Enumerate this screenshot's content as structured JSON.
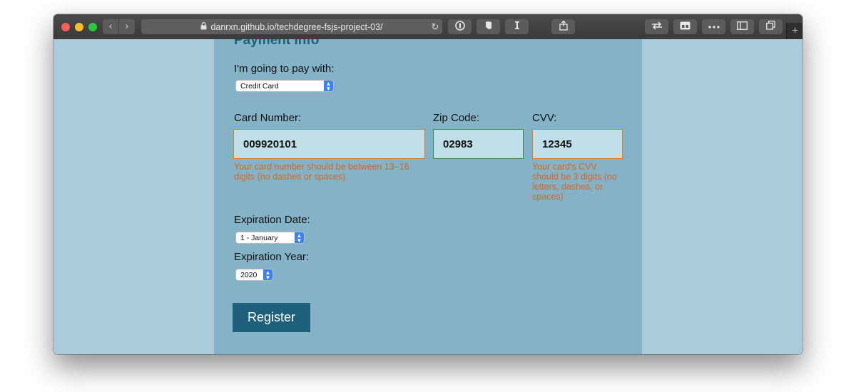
{
  "browser": {
    "url": "danrxn.github.io/techdegree-fsjs-project-03/",
    "nav_back_icon": "‹",
    "nav_forward_icon": "›",
    "lock_icon": "🔒",
    "reload_icon": "↻",
    "new_tab_icon": "+"
  },
  "payment": {
    "title": "Payment Info",
    "pay_with_label": "I'm going to pay with:",
    "pay_with_selected": "Credit Card",
    "card_number_label": "Card Number:",
    "card_number_value": "009920101",
    "card_number_error": "Your card number should be between 13–16 digits (no dashes or spaces)",
    "zip_label": "Zip Code:",
    "zip_value": "02983",
    "cvv_label": "CVV:",
    "cvv_value": "12345",
    "cvv_error": "Your card's CVV should be 3 digits (no letters, dashes, or spaces)",
    "exp_date_label": "Expiration Date:",
    "exp_date_selected": "1 - January",
    "exp_year_label": "Expiration Year:",
    "exp_year_selected": "2020",
    "register_label": "Register"
  },
  "colors": {
    "panel": "#84b3c8",
    "page_bg": "#aacbd9",
    "heading": "#1e5f7b",
    "error": "#d8651f",
    "error_border": "#e07b2a",
    "valid_border": "#2e8b57",
    "button": "#1e5f7b"
  }
}
